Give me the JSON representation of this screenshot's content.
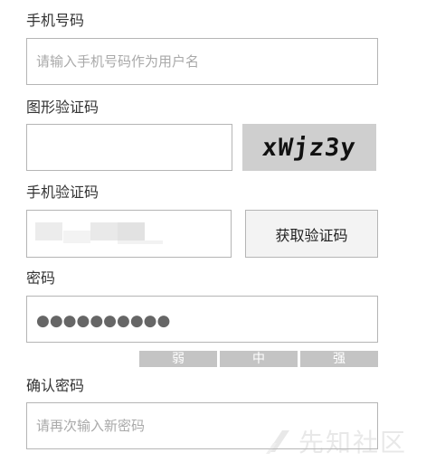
{
  "form": {
    "phone": {
      "label": "手机号码",
      "placeholder": "请输入手机号码作为用户名"
    },
    "captcha": {
      "label": "图形验证码",
      "image_text": "xWjz3y"
    },
    "sms_code": {
      "label": "手机验证码",
      "button_label": "获取验证码"
    },
    "password": {
      "label": "密码",
      "masked_value": "●●●●●●●●●●"
    },
    "strength": {
      "weak": "弱",
      "medium": "中",
      "strong": "强"
    },
    "confirm_password": {
      "label": "确认密码",
      "placeholder": "请再次输入新密码"
    }
  },
  "watermark": {
    "text": "先知社区"
  },
  "colors": {
    "border": "#b5b5b5",
    "captcha_bg": "#cfcfcf",
    "strength_bar": "#c4c4c4",
    "button_bg": "#f3f3f3"
  }
}
